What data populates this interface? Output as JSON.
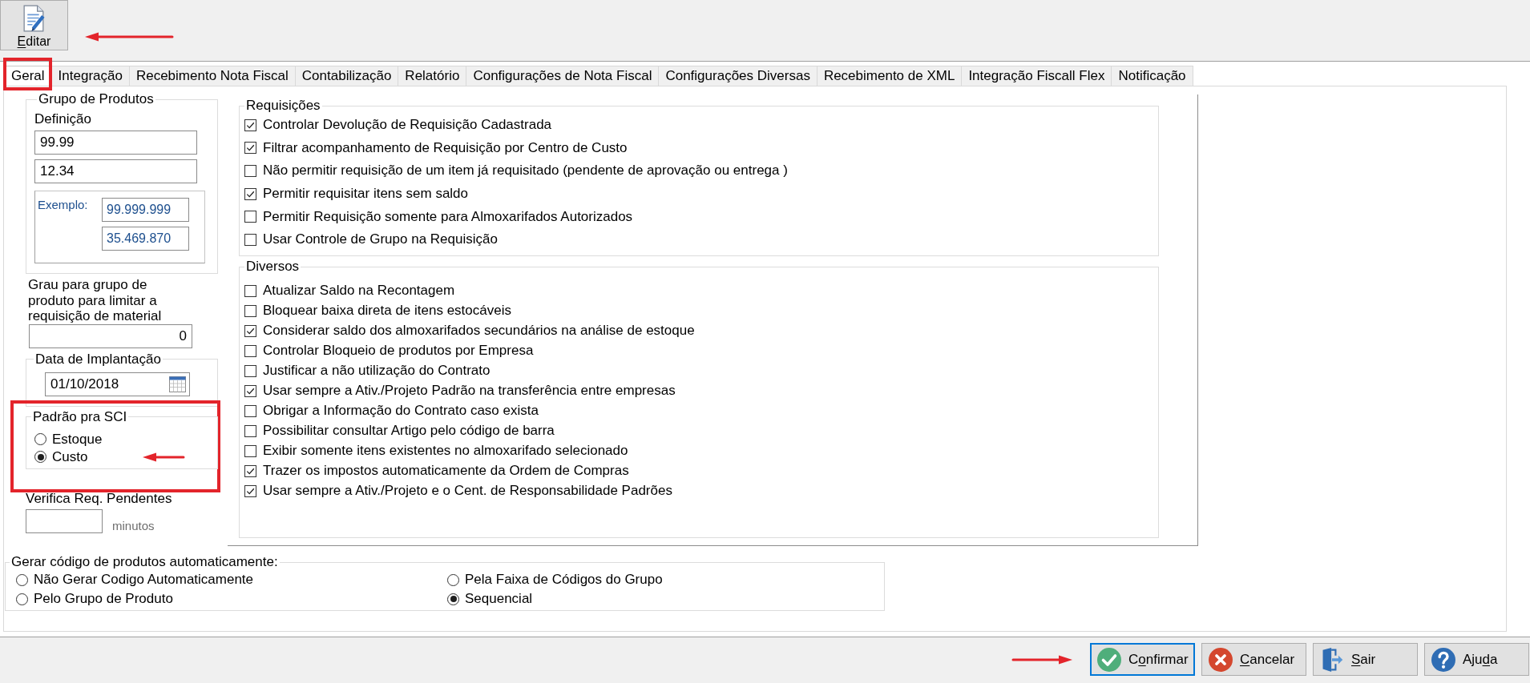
{
  "toolbar": {
    "buttons": [
      {
        "label_parts": [
          {
            "text": "E",
            "underlined": true
          },
          {
            "text": "ditar",
            "underlined": false
          }
        ],
        "arrow": true
      }
    ]
  },
  "tabs": [
    {
      "label": "Geral",
      "selected": true,
      "highlighted": true
    },
    {
      "label": "Integração",
      "selected": false,
      "highlighted": false
    },
    {
      "label": "Recebimento Nota Fiscal",
      "selected": false,
      "highlighted": false
    },
    {
      "label": "Contabilização",
      "selected": false,
      "highlighted": false
    },
    {
      "label": "Relatório",
      "selected": false,
      "highlighted": false
    },
    {
      "label": "Configurações de Nota Fiscal",
      "selected": false,
      "highlighted": false
    },
    {
      "label": "Configurações Diversas",
      "selected": false,
      "highlighted": false
    },
    {
      "label": "Recebimento de XML",
      "selected": false,
      "highlighted": false
    },
    {
      "label": "Integração Fiscall Flex",
      "selected": false,
      "highlighted": false
    },
    {
      "label": "Notificação",
      "selected": false,
      "highlighted": false
    }
  ],
  "grupo_de_produtos": {
    "title": "Grupo de Produtos",
    "definition_label": "Definição",
    "fields": [
      {
        "value": "99.99"
      },
      {
        "value": "12.34"
      }
    ],
    "example": {
      "label": "Exemplo:",
      "values": [
        "99.999.999",
        "35.469.870"
      ]
    }
  },
  "grau": {
    "label": "Grau para grupo de produto para limitar a requisição de material",
    "value": "0"
  },
  "data_de_implantacao": {
    "title": "Data de Implantação",
    "value": "01/10/2018"
  },
  "padrao_sci": {
    "title": "Padrão pra SCI",
    "highlighted": true,
    "options": [
      {
        "label": "Estoque",
        "selected": false,
        "arrow": false
      },
      {
        "label": "Custo",
        "selected": true,
        "arrow": true
      }
    ]
  },
  "verifica_req": {
    "label": "Verifica Req. Pendentes",
    "unit": "minutos"
  },
  "requisicoes": {
    "title": "Requisições",
    "items": [
      {
        "label": "Controlar Devolução de Requisição Cadastrada",
        "checked": true
      },
      {
        "label": "Filtrar acompanhamento de Requisição por Centro de Custo",
        "checked": true
      },
      {
        "label": "Não permitir requisição de um item já requisitado (pendente de aprovação ou entrega )",
        "checked": false
      },
      {
        "label": "Permitir requisitar itens sem saldo",
        "checked": true
      },
      {
        "label": "Permitir Requisição somente para Almoxarifados Autorizados",
        "checked": false
      },
      {
        "label": "Usar Controle de Grupo na Requisição",
        "checked": false
      }
    ]
  },
  "diversos": {
    "title": "Diversos",
    "items": [
      {
        "label": "Atualizar Saldo na Recontagem",
        "checked": false
      },
      {
        "label": "Bloquear baixa direta de itens estocáveis",
        "checked": false
      },
      {
        "label": "Considerar saldo dos almoxarifados secundários na análise de estoque",
        "checked": true
      },
      {
        "label": "Controlar Bloqueio de produtos por Empresa",
        "checked": false
      },
      {
        "label": "Justificar a não utilização do Contrato",
        "checked": false
      },
      {
        "label": "Usar sempre a Ativ./Projeto Padrão na transferência entre empresas",
        "checked": true
      },
      {
        "label": "Obrigar a Informação do Contrato caso exista",
        "checked": false
      },
      {
        "label": "Possibilitar consultar Artigo pelo código de barra",
        "checked": false
      },
      {
        "label": "Exibir somente itens existentes no almoxarifado selecionado",
        "checked": false
      },
      {
        "label": "Trazer os impostos automaticamente da Ordem de Compras",
        "checked": true
      },
      {
        "label": "Usar sempre a Ativ./Projeto e o Cent. de Responsabilidade Padrões",
        "checked": true
      }
    ]
  },
  "gerar_codigo": {
    "title": "Gerar código de produtos automaticamente:",
    "options": [
      {
        "label": "Não Gerar Codigo Automaticamente",
        "selected": false
      },
      {
        "label": "Pela Faixa de Códigos do Grupo",
        "selected": false
      },
      {
        "label": "Pelo Grupo de Produto",
        "selected": false
      },
      {
        "label": "Sequencial",
        "selected": true
      }
    ]
  },
  "footer": {
    "buttons": [
      {
        "kind": "confirm",
        "label_parts": [
          {
            "text": "C",
            "underlined": false
          },
          {
            "text": "o",
            "underlined": true
          },
          {
            "text": "nfirmar",
            "underlined": false
          }
        ],
        "focused": true,
        "arrow": true
      },
      {
        "kind": "cancel",
        "label_parts": [
          {
            "text": "C",
            "underlined": true
          },
          {
            "text": "ancelar",
            "underlined": false
          }
        ],
        "focused": false,
        "arrow": false
      },
      {
        "kind": "exit",
        "label_parts": [
          {
            "text": "S",
            "underlined": true
          },
          {
            "text": "air",
            "underlined": false
          }
        ],
        "focused": false,
        "arrow": false
      },
      {
        "kind": "help",
        "label_parts": [
          {
            "text": "Aju",
            "underlined": false
          },
          {
            "text": "d",
            "underlined": true
          },
          {
            "text": "a",
            "underlined": false
          }
        ],
        "focused": false,
        "arrow": false
      }
    ]
  }
}
